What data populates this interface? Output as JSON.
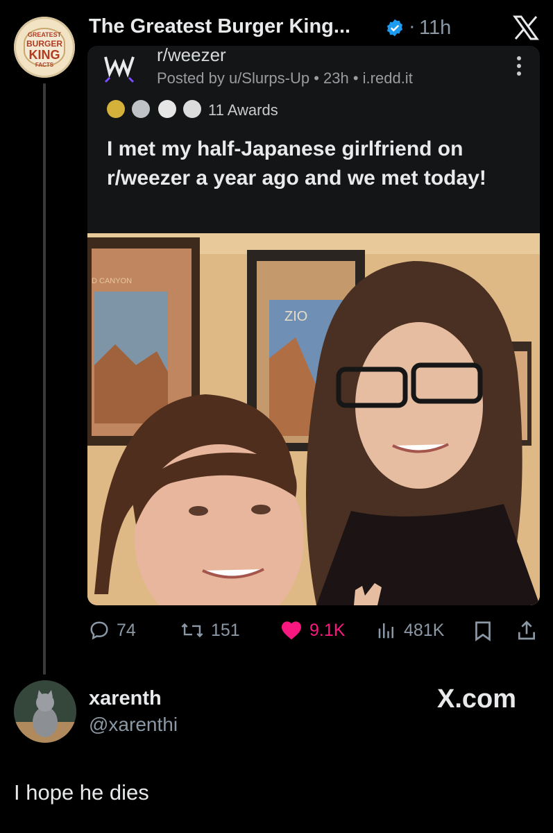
{
  "tweet": {
    "author": "The Greatest Burger King...",
    "separator": "·",
    "time": "11h",
    "avatar_text": {
      "top": "GREATEST",
      "mid": "BURGER",
      "main": "KING",
      "bottom": "FACTS"
    }
  },
  "reddit": {
    "subreddit": "r/weezer",
    "meta": "Posted by u/Slurps-Up • 23h • i.redd.it",
    "awards": "11 Awards",
    "title": "I met my half-Japanese girlfriend on r/weezer a year ago and we met today!",
    "photo_wall_label": "D CANYON",
    "photo_sign_label": "ZIO"
  },
  "actions": {
    "replies": "74",
    "retweets": "151",
    "likes": "9.1K",
    "views": "481K"
  },
  "reply": {
    "name": "xarenth",
    "handle": "@xarenthi",
    "watermark": "X.com",
    "text": "I hope he dies"
  },
  "colors": {
    "background": "#000000",
    "like_pink": "#f91880",
    "verified_blue": "#1d9bf0",
    "muted_text": "#8b98a5",
    "card_bg": "#141516"
  }
}
